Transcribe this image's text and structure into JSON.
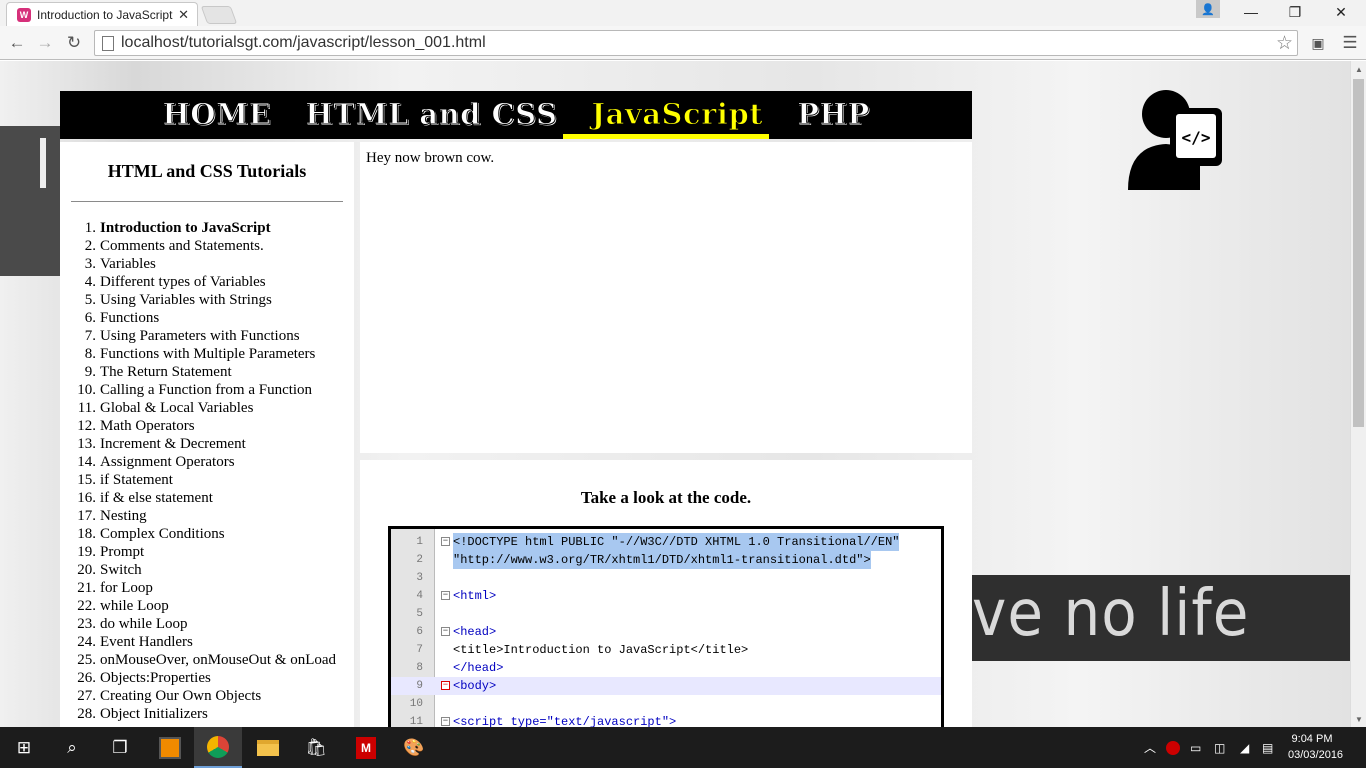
{
  "browser": {
    "tab_title": "Introduction to JavaScript",
    "url": "localhost/tutorialsgt.com/javascript/lesson_001.html"
  },
  "nav": {
    "items": [
      "HOME",
      "HTML and CSS",
      "JavaScript",
      "PHP"
    ],
    "active": "JavaScript"
  },
  "sidebar": {
    "title": "HTML and CSS Tutorials",
    "lessons": [
      {
        "num": "1.",
        "label": "Introduction to JavaScript",
        "current": true
      },
      {
        "num": "2.",
        "label": "Comments and Statements."
      },
      {
        "num": "3.",
        "label": "Variables"
      },
      {
        "num": "4.",
        "label": "Different types of Variables"
      },
      {
        "num": "5.",
        "label": "Using Variables with Strings"
      },
      {
        "num": "6.",
        "label": "Functions"
      },
      {
        "num": "7.",
        "label": "Using Parameters with Functions"
      },
      {
        "num": "8.",
        "label": "Functions with Multiple Parameters"
      },
      {
        "num": "9.",
        "label": "The Return Statement"
      },
      {
        "num": "10.",
        "label": "Calling a Function from a Function"
      },
      {
        "num": "11.",
        "label": "Global & Local Variables"
      },
      {
        "num": "12.",
        "label": "Math Operators"
      },
      {
        "num": "13.",
        "label": "Increment & Decrement"
      },
      {
        "num": "14.",
        "label": "Assignment Operators"
      },
      {
        "num": "15.",
        "label": "if Statement"
      },
      {
        "num": "16.",
        "label": "if & else statement"
      },
      {
        "num": "17.",
        "label": "Nesting"
      },
      {
        "num": "18.",
        "label": "Complex Conditions"
      },
      {
        "num": "19.",
        "label": "Prompt"
      },
      {
        "num": "20.",
        "label": "Switch"
      },
      {
        "num": "21.",
        "label": "for Loop"
      },
      {
        "num": "22.",
        "label": "while Loop"
      },
      {
        "num": "23.",
        "label": "do while Loop"
      },
      {
        "num": "24.",
        "label": "Event Handlers"
      },
      {
        "num": "25.",
        "label": "onMouseOver, onMouseOut & onLoad"
      },
      {
        "num": "26.",
        "label": "Objects:Properties"
      },
      {
        "num": "27.",
        "label": "Creating Our Own Objects"
      },
      {
        "num": "28.",
        "label": "Object Initializers"
      }
    ]
  },
  "content": {
    "output_text": "Hey now brown cow.",
    "code_heading": "Take a look at the code."
  },
  "code": {
    "lines": [
      {
        "n": "1",
        "text": "<!DOCTYPE html PUBLIC \"-//W3C//DTD XHTML 1.0 Transitional//EN\"",
        "style": "sel",
        "fold": "minus"
      },
      {
        "n": "2",
        "text": "\"http://www.w3.org/TR/xhtml1/DTD/xhtml1-transitional.dtd\">",
        "style": "sel"
      },
      {
        "n": "3",
        "text": ""
      },
      {
        "n": "4",
        "text": "<html>",
        "style": "tag",
        "fold": "minus"
      },
      {
        "n": "5",
        "text": ""
      },
      {
        "n": "6",
        "text": "<head>",
        "style": "tag",
        "fold": "minus"
      },
      {
        "n": "7",
        "text": "<title>Introduction to JavaScript</title>"
      },
      {
        "n": "8",
        "text": "</head>",
        "style": "tag"
      },
      {
        "n": "9",
        "text": "<body>",
        "style": "tag",
        "fold": "red",
        "highlight": true
      },
      {
        "n": "10",
        "text": ""
      },
      {
        "n": "11",
        "text": "<script type=\"text/javascript\">",
        "style": "tag",
        "fold": "minus"
      }
    ]
  },
  "background_text": "ve no life",
  "taskbar": {
    "time": "9:04 PM",
    "date": "03/03/2016"
  }
}
